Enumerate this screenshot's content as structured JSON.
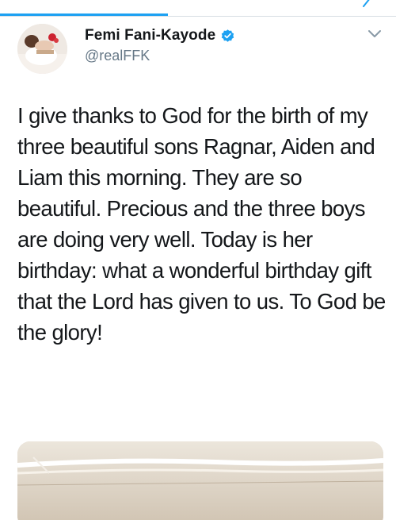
{
  "tweet": {
    "author": {
      "display_name": "Femi Fani-Kayode",
      "handle": "@realFFK",
      "verified": true
    },
    "text": "I give thanks to God for the birth of my three beautiful sons Ragnar, Aiden and Liam this morning. They are so beautiful. Precious and the three boys are doing very well. Today is her birthday: what a wonderful birthday gift that the Lord has given to us. To God be the glory!"
  },
  "colors": {
    "accent": "#1da1f2",
    "text": "#14171a",
    "secondary_text": "#657786",
    "divider": "#d7dee3"
  },
  "icons": {
    "verified": "verified-badge-icon",
    "menu": "chevron-down-icon",
    "top_partial": "share-icon"
  }
}
